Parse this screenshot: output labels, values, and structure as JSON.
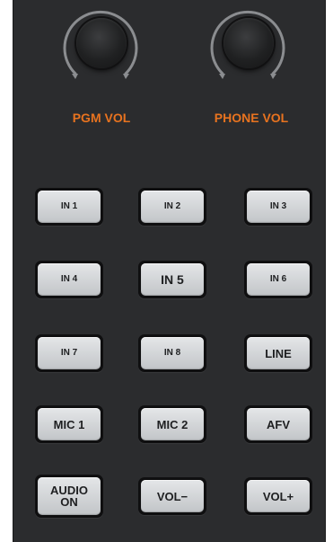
{
  "knobs": [
    {
      "name": "pgm-vol",
      "label": "PGM VOL"
    },
    {
      "name": "phone-vol",
      "label": "PHONE VOL"
    }
  ],
  "buttons": {
    "in1": "IN 1",
    "in2": "IN 2",
    "in3": "IN 3",
    "in4": "IN 4",
    "in5": "IN 5",
    "in6": "IN 6",
    "in7": "IN 7",
    "in8": "IN 8",
    "line": "LINE",
    "mic1": "MIC 1",
    "mic2": "MIC 2",
    "afv": "AFV",
    "audio_on": "AUDIO\nON",
    "vol_minus": "VOL−",
    "vol_plus": "VOL+"
  },
  "colors": {
    "panel": "#2b2c2e",
    "knob_label": "#e8731f",
    "button_face": "#d6d8da",
    "button_text": "#1e1f21"
  }
}
